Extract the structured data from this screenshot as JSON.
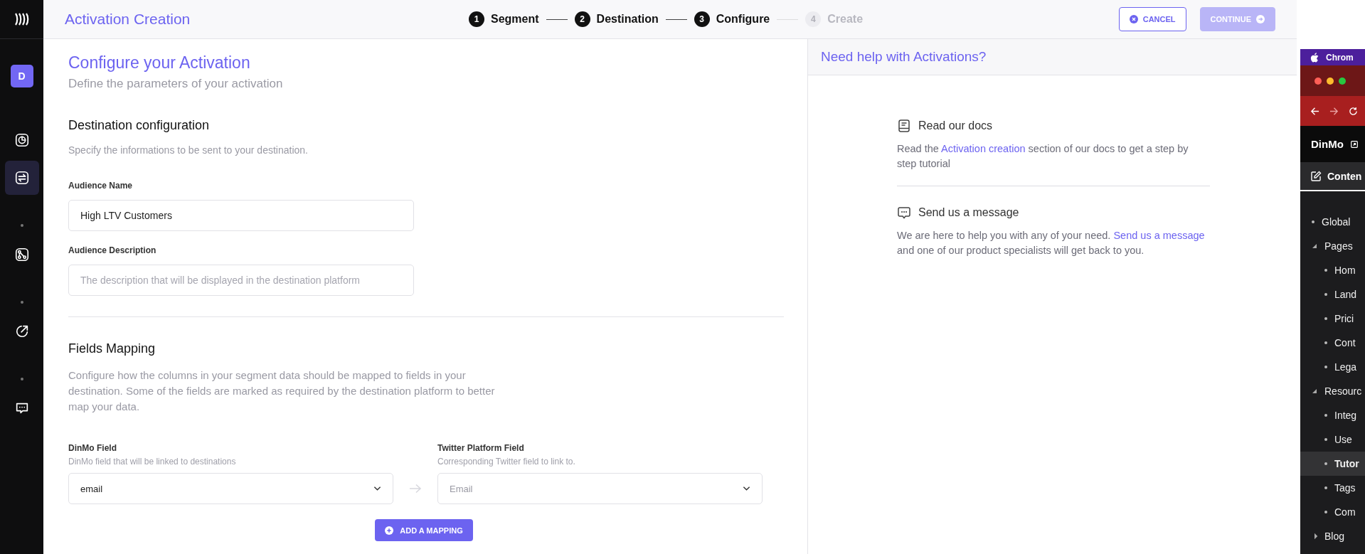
{
  "sidebar": {
    "avatar": "D",
    "items": [
      {
        "selected": false
      },
      {
        "selected": true
      },
      {
        "selected": false
      },
      {
        "selected": false
      },
      {
        "selected": false
      }
    ]
  },
  "header": {
    "title": "Activation Creation",
    "steps": [
      {
        "number": "1",
        "label": "Segment",
        "disabled": false
      },
      {
        "number": "2",
        "label": "Destination",
        "disabled": false
      },
      {
        "number": "3",
        "label": "Configure",
        "disabled": false
      },
      {
        "number": "4",
        "label": "Create",
        "disabled": true
      }
    ],
    "buttons": [
      {
        "label": "CANCEL",
        "kind": "outline",
        "disabled": false
      },
      {
        "label": "CONTINUE",
        "kind": "primary",
        "disabled": true
      }
    ]
  },
  "form": {
    "title": "Configure your Activation",
    "subtitle": "Define the parameters of your activation",
    "destination": {
      "heading": "Destination configuration",
      "description": "Specify the informations to be sent to your destination.",
      "fields": [
        {
          "label": "Audience Name",
          "value": "High LTV Customers"
        },
        {
          "label": "Audience Description",
          "placeholder": "The description that will be displayed in the destination platform"
        }
      ]
    },
    "mapping": {
      "heading": "Fields Mapping",
      "description": "Configure how the columns in your segment data should be mapped to fields in your destination. Some of the fields are marked as required by the destination platform to better map your data.",
      "source": {
        "label": "DinMo Field",
        "hint": "DinMo field that will be linked to destinations",
        "value": "email"
      },
      "target": {
        "label": "Twitter Platform Field",
        "hint": "Corresponding Twitter field to link to.",
        "placeholder": "Email"
      },
      "add_button": "ADD A MAPPING"
    }
  },
  "help": {
    "title": "Need help with Activations?",
    "sections": [
      {
        "kind": "docs",
        "heading": "Read our docs",
        "text_before": "Read the ",
        "link": "Activation creation",
        "text_after": " section of our docs to get a step by step tutorial"
      },
      {
        "kind": "message",
        "heading": "Send us a message",
        "text_before": "We are here to help you with any of your need. ",
        "link": "Send us a message",
        "text_after": " and one of our product specialists will get back to you."
      }
    ]
  },
  "browser_window": {
    "menu_app": "Chrom",
    "site_title": "DinMo",
    "tab": "Conten",
    "tree": [
      {
        "label": "Global",
        "selected": false
      },
      {
        "label": "Pages",
        "selected": false,
        "expanded": true,
        "children": [
          {
            "label": "Hom",
            "selected": false
          },
          {
            "label": "Land",
            "selected": false
          },
          {
            "label": "Prici",
            "selected": false
          },
          {
            "label": "Cont",
            "selected": false
          },
          {
            "label": "Lega",
            "selected": false
          }
        ]
      },
      {
        "label": "Resourc",
        "selected": false,
        "expanded": true,
        "children": [
          {
            "label": "Integ",
            "selected": false
          },
          {
            "label": "Use",
            "selected": false
          },
          {
            "label": "Tutor",
            "selected": true
          },
          {
            "label": "Tags",
            "selected": false
          },
          {
            "label": "Com",
            "selected": false
          }
        ]
      },
      {
        "label": "Blog",
        "selected": false,
        "expanded": false
      }
    ]
  }
}
